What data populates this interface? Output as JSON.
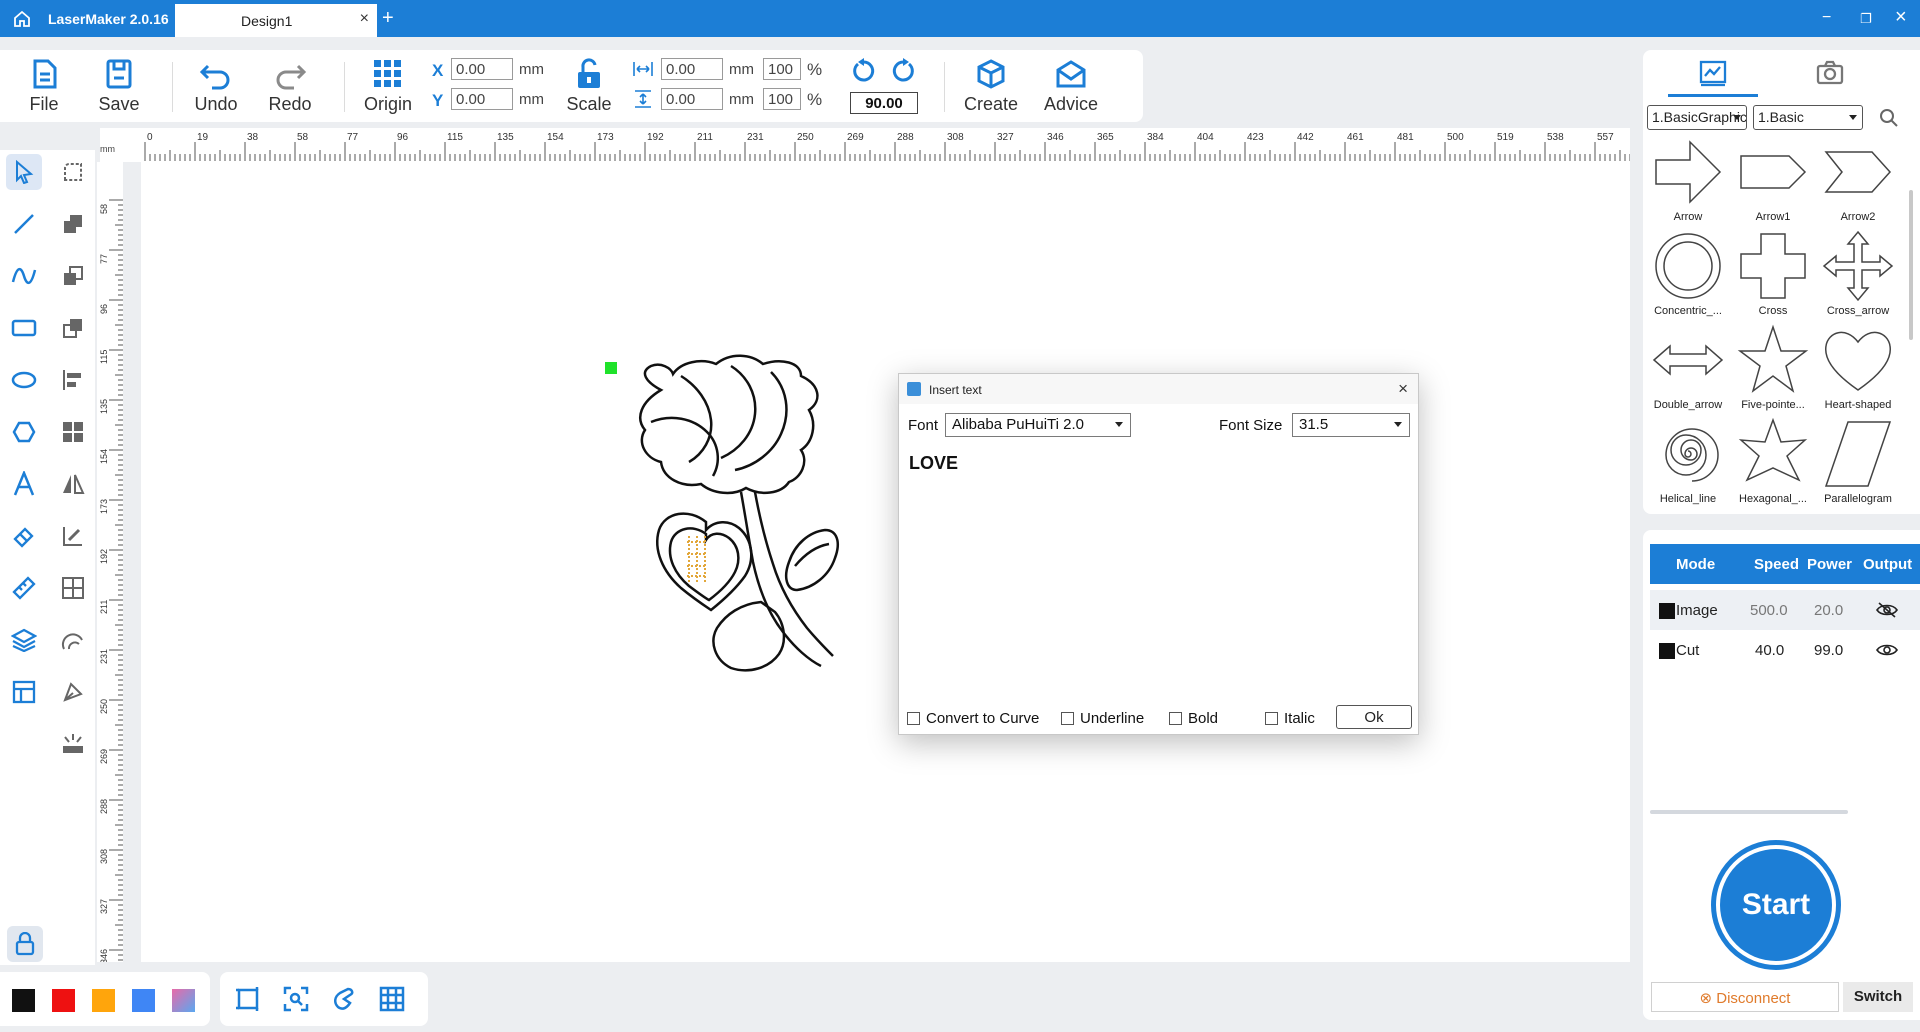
{
  "titlebar": {
    "app_title": "LaserMaker 2.0.16",
    "tab_name": "Design1",
    "tab_close": "×",
    "new_tab": "+",
    "minimize": "−",
    "maximize": "❐",
    "close": "×"
  },
  "toolbar": {
    "file": "File",
    "save": "Save",
    "undo": "Undo",
    "redo": "Redo",
    "origin": "Origin",
    "scale": "Scale",
    "create": "Create",
    "advice": "Advice",
    "x_label": "X",
    "y_label": "Y",
    "x_value": "0.00",
    "y_value": "0.00",
    "unit": "mm",
    "width_value": "0.00",
    "height_value": "0.00",
    "width_pct": "100",
    "height_pct": "100",
    "pct": "%",
    "rotation": "90.00"
  },
  "ruler": {
    "unit": "mm",
    "top_ticks": [
      "0",
      "19",
      "38",
      "58",
      "77",
      "96",
      "115",
      "135",
      "154",
      "173",
      "192",
      "211",
      "231",
      "250",
      "269",
      "288",
      "308",
      "327",
      "346",
      "365",
      "384",
      "404",
      "423",
      "442",
      "461",
      "481",
      "500",
      "519",
      "538",
      "557"
    ],
    "left_ticks": [
      "58",
      "77",
      "96",
      "115",
      "135",
      "154",
      "173",
      "192",
      "211",
      "231",
      "250",
      "269",
      "288",
      "308",
      "327",
      "346"
    ]
  },
  "dialog": {
    "title": "Insert text",
    "close": "×",
    "font_label": "Font",
    "font_value": "Alibaba PuHuiTi 2.0",
    "size_label": "Font Size",
    "size_value": "31.5",
    "text": "LOVE",
    "convert": "Convert to Curve",
    "underline": "Underline",
    "bold": "Bold",
    "italic": "Italic",
    "ok": "Ok"
  },
  "library": {
    "category": "1.BasicGraphic",
    "subcategory": "1.Basic",
    "shapes": [
      "Arrow",
      "Arrow1",
      "Arrow2",
      "Concentric_...",
      "Cross",
      "Cross_arrow",
      "Double_arrow",
      "Five-pointe...",
      "Heart-shaped",
      "Helical_line",
      "Hexagonal_...",
      "Parallelogram"
    ]
  },
  "layers": {
    "headers": {
      "mode": "Mode",
      "speed": "Speed",
      "power": "Power",
      "output": "Output"
    },
    "rows": [
      {
        "mode": "Image",
        "speed": "500.0",
        "power": "20.0",
        "color": "#111111"
      },
      {
        "mode": "Cut",
        "speed": "40.0",
        "power": "99.0",
        "color": "#111111"
      }
    ]
  },
  "actions": {
    "start": "Start",
    "disconnect": "Disconnect",
    "switch": "Switch"
  },
  "colors": {
    "accent": "#1c7ed6",
    "swatches": [
      "#111111",
      "#ee1111",
      "#ffa50c",
      "#3f86f5",
      "#e86aa8"
    ],
    "warning": "#e07b2c"
  }
}
